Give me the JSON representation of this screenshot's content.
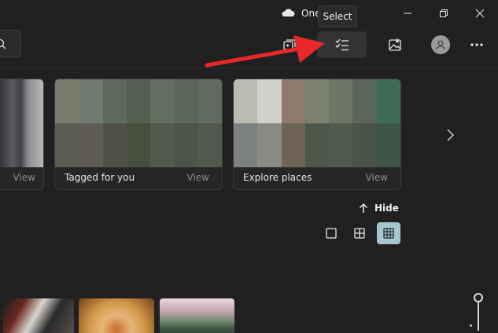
{
  "titlebar": {
    "onedrive_label": "One",
    "tooltip": "Select"
  },
  "cards": [
    {
      "title": "",
      "view_label": "View"
    },
    {
      "title": "Tagged for you",
      "view_label": "View"
    },
    {
      "title": "Explore places",
      "view_label": "View"
    }
  ],
  "view_options": {
    "hide_label": "Hide"
  },
  "colors": {
    "annotation_arrow": "#e8262b",
    "selected_view": "#a6c6cf"
  }
}
